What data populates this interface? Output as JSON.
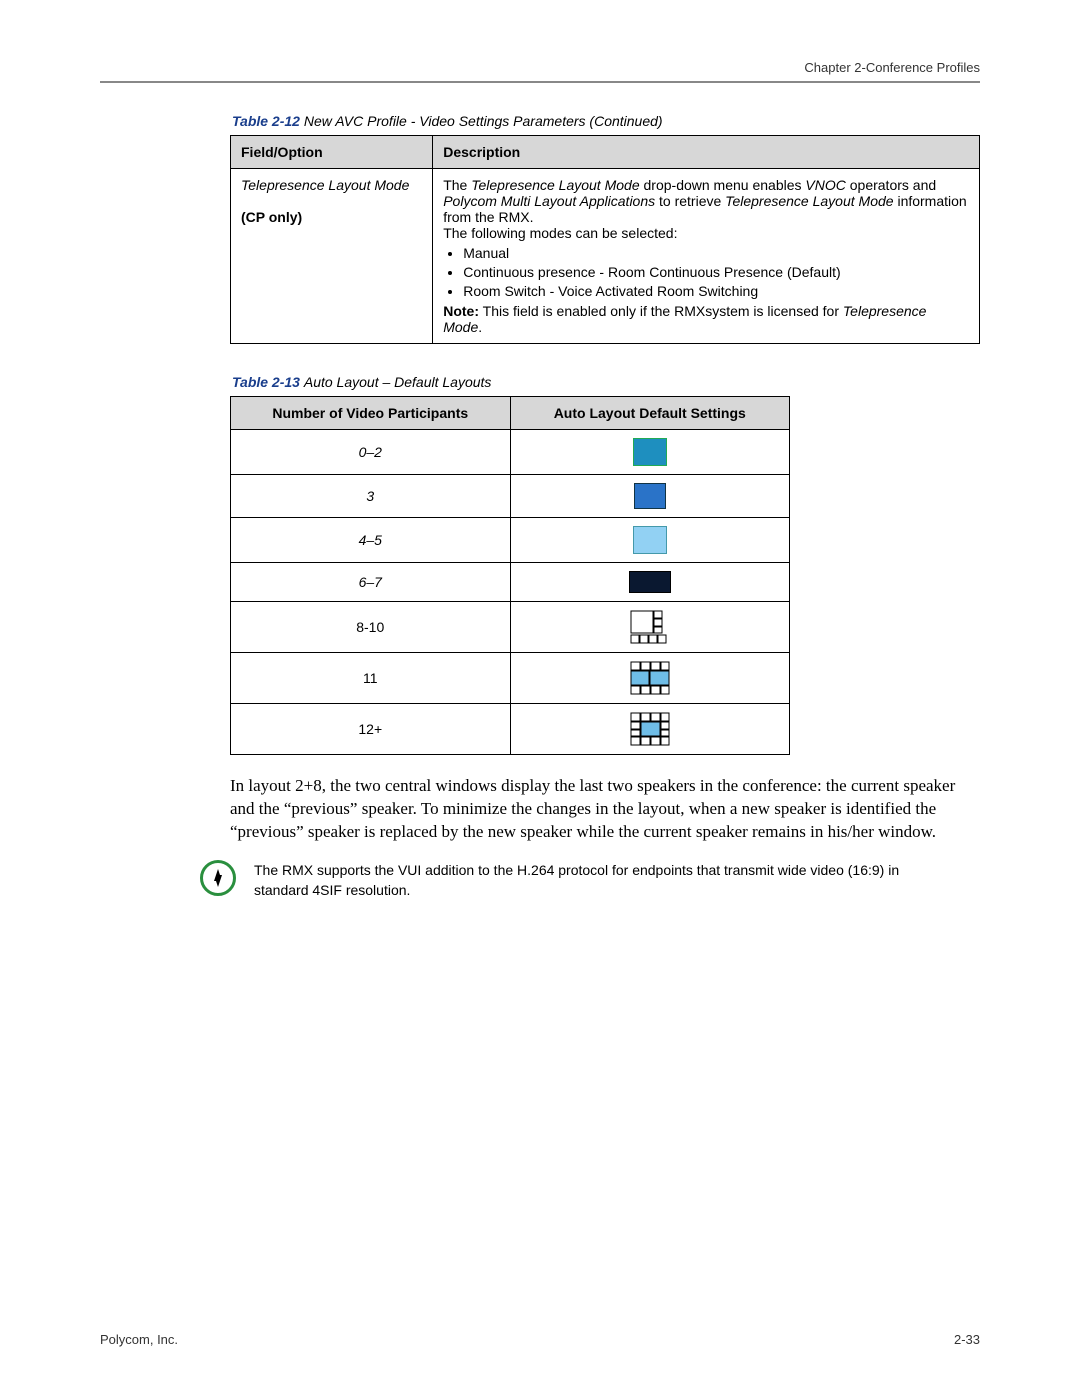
{
  "running_head": "Chapter 2-Conference Profiles",
  "table212": {
    "caption_label": "Table 2-12",
    "caption_text": "New AVC Profile - Video Settings Parameters (Continued)",
    "head_field": "Field/Option",
    "head_desc": "Description",
    "row": {
      "field_line1": "Telepresence Layout Mode",
      "field_line2": "(CP only)",
      "desc_intro_a": "The ",
      "desc_intro_b": "Telepresence Layout Mode",
      "desc_intro_c": " drop-down menu enables ",
      "desc_intro_d": "VNOC",
      "desc_intro_e": " operators and ",
      "desc_intro_f": "Polycom Multi Layout Applications",
      "desc_intro_g": " to retrieve ",
      "desc_intro_h": "Telepresence Layout Mode",
      "desc_intro_i": " information from the RMX.",
      "desc_select": "The following modes can be selected:",
      "bullet1": "Manual",
      "bullet2": "Continuous presence - Room Continuous Presence (Default)",
      "bullet3": "Room Switch - Voice Activated Room Switching",
      "note_a": "Note:",
      "note_b": " This field is enabled only if the RMXsystem is licensed for ",
      "note_c": "Telepresence Mode",
      "note_d": "."
    }
  },
  "table213": {
    "caption_label": "Table 2-13",
    "caption_text": "Auto Layout – Default Layouts",
    "head_left": "Number of Video Participants",
    "head_right": "Auto Layout Default Settings",
    "rows": [
      {
        "n": "0–2",
        "icon": "layout-1"
      },
      {
        "n": "3",
        "icon": "layout-1-blue"
      },
      {
        "n": "4–5",
        "icon": "layout-1-light"
      },
      {
        "n": "6–7",
        "icon": "layout-1-dark"
      },
      {
        "n": "8-10",
        "icon": "layout-1plus7"
      },
      {
        "n": "11",
        "icon": "layout-2plus8"
      },
      {
        "n": "12+",
        "icon": "layout-1plus12"
      }
    ]
  },
  "body_para": "In layout 2+8, the two central windows display the last two speakers in the conference: the current speaker and the “previous” speaker. To minimize the changes in the layout, when a new speaker is identified the “previous” speaker is replaced by the new speaker while the current speaker remains in his/her window.",
  "note_box": "The RMX supports the VUI addition to the H.264 protocol for endpoints that transmit wide video (16:9) in standard 4SIF resolution.",
  "footer_left": "Polycom, Inc.",
  "footer_right": "2-33"
}
